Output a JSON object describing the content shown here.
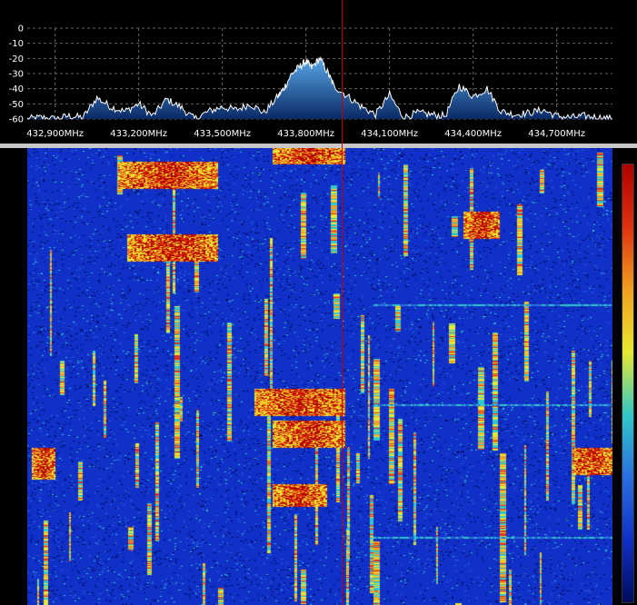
{
  "spectrum": {
    "y_ticks": [
      "0",
      "-10",
      "-20",
      "-30",
      "-40",
      "-50",
      "-60"
    ],
    "y_values": [
      0,
      -10,
      -20,
      -30,
      -40,
      -50,
      -60
    ],
    "ylim": [
      -60,
      0
    ],
    "freq_labels": [
      "432,900MHz",
      "433,200MHz",
      "433,500MHz",
      "433,800MHz",
      "434,100MHz",
      "434,400MHz",
      "434,700MHz"
    ],
    "freq_mhz": [
      432.9,
      433.2,
      433.5,
      433.8,
      434.1,
      434.4,
      434.7
    ],
    "xlim_mhz": [
      432.8,
      434.9
    ],
    "tuned_freq_mhz": 434.0,
    "colors": {
      "grid": "#666666",
      "trace": "#ffffff",
      "fill_top": "#5aa8e8",
      "fill_bottom": "#0a2a66",
      "marker": "#c00000",
      "text": "#ffffff"
    }
  },
  "chart_data": {
    "type": "area",
    "x": [
      432.8,
      432.85,
      432.9,
      432.95,
      433.0,
      433.05,
      433.1,
      433.15,
      433.2,
      433.25,
      433.3,
      433.35,
      433.4,
      433.45,
      433.5,
      433.55,
      433.6,
      433.65,
      433.7,
      433.72,
      433.75,
      433.78,
      433.8,
      433.82,
      433.85,
      433.88,
      433.9,
      433.95,
      434.0,
      434.05,
      434.1,
      434.15,
      434.2,
      434.25,
      434.3,
      434.35,
      434.4,
      434.45,
      434.5,
      434.55,
      434.6,
      434.65,
      434.7,
      434.75,
      434.8,
      434.85,
      434.9
    ],
    "series": [
      {
        "values": [
          -60,
          -59,
          -60,
          -58,
          -59,
          -46,
          -52,
          -55,
          -50,
          -58,
          -47,
          -52,
          -60,
          -55,
          -52,
          -54,
          -50,
          -56,
          -45,
          -40,
          -30,
          -25,
          -22,
          -26,
          -20,
          -30,
          -38,
          -45,
          -52,
          -57,
          -44,
          -59,
          -56,
          -57,
          -58,
          -38,
          -45,
          -40,
          -55,
          -57,
          -56,
          -54,
          -58,
          -59,
          -58,
          -59,
          -60
        ]
      }
    ],
    "xlabel": "",
    "ylabel": "",
    "ylim": [
      -60,
      0
    ],
    "grid": true
  },
  "waterfall": {
    "palette": [
      "#000a5a",
      "#1030c8",
      "#2a6fe0",
      "#30c8c8",
      "#e8e830",
      "#f0a020",
      "#e03010",
      "#b00000"
    ]
  }
}
